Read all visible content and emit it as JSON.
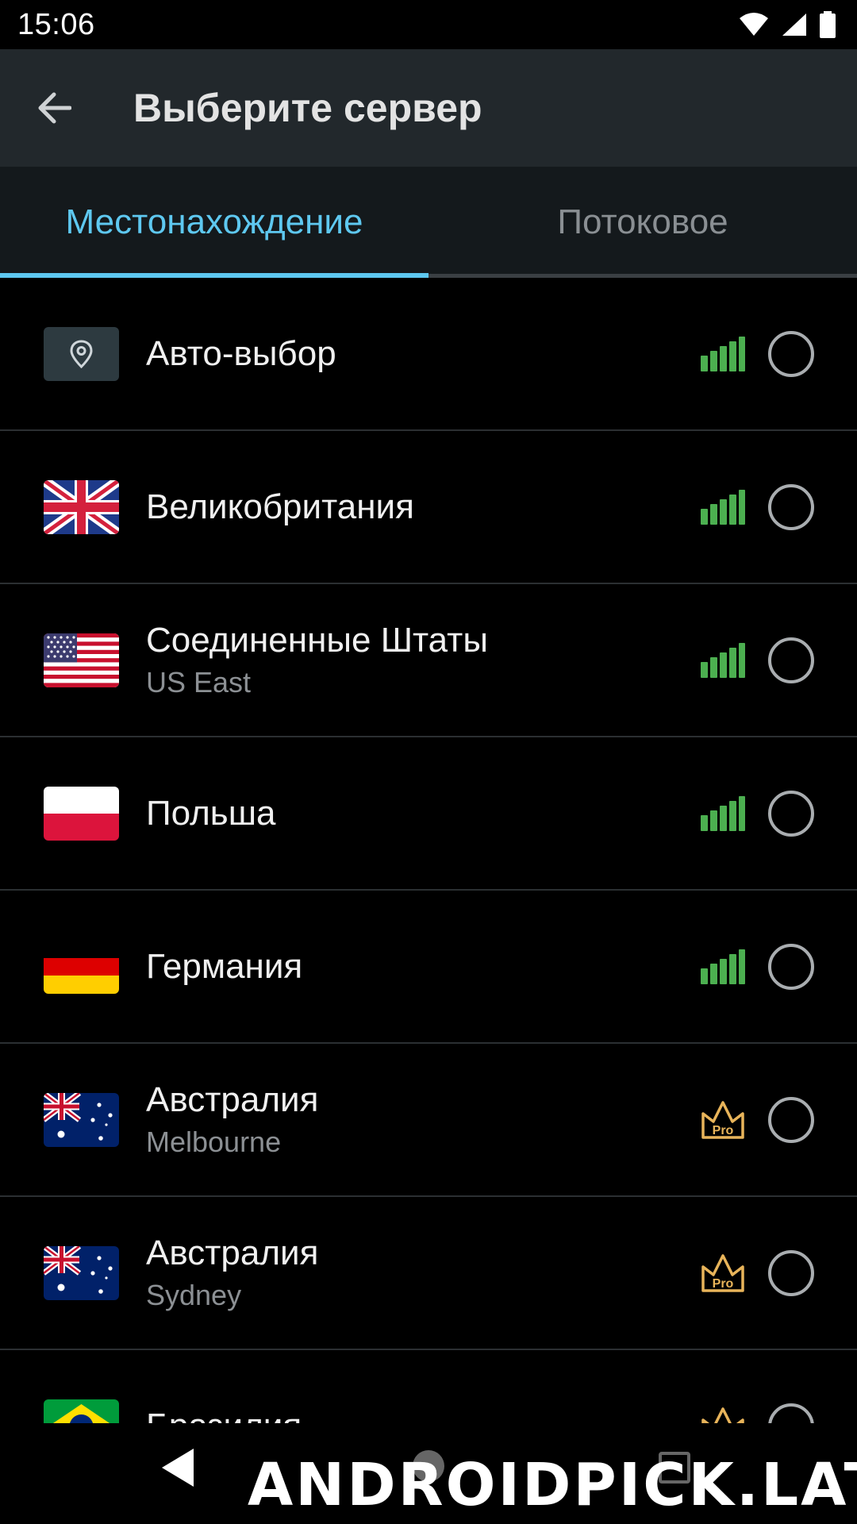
{
  "status_bar": {
    "time": "15:06"
  },
  "header": {
    "title": "Выберите сервер"
  },
  "tabs": [
    {
      "label": "Местонахождение",
      "active": true
    },
    {
      "label": "Потоковое",
      "active": false
    }
  ],
  "servers": [
    {
      "name": "Авто-выбор",
      "subtitle": "",
      "flag": "location-pin-icon",
      "status": "signal"
    },
    {
      "name": "Великобритания",
      "subtitle": "",
      "flag": "uk-flag-icon",
      "status": "signal"
    },
    {
      "name": "Соединенные Штаты",
      "subtitle": "US East",
      "flag": "us-flag-icon",
      "status": "signal"
    },
    {
      "name": "Польша",
      "subtitle": "",
      "flag": "poland-flag-icon",
      "status": "signal"
    },
    {
      "name": "Германия",
      "subtitle": "",
      "flag": "germany-flag-icon",
      "status": "signal"
    },
    {
      "name": "Австралия",
      "subtitle": "Melbourne",
      "flag": "australia-flag-icon",
      "status": "pro"
    },
    {
      "name": "Австралия",
      "subtitle": "Sydney",
      "flag": "australia-flag-icon",
      "status": "pro"
    },
    {
      "name": "Бразилия",
      "subtitle": "",
      "flag": "brazil-flag-icon",
      "status": "pro"
    }
  ],
  "badges": {
    "pro_label": "Pro"
  },
  "watermark": "ANDROIDPICK.LAT",
  "colors": {
    "accent": "#5ec8f0",
    "signal": "#4caf50",
    "pro": "#e8b45a",
    "app_bar": "#22282c",
    "tab_bar": "#14191c"
  }
}
